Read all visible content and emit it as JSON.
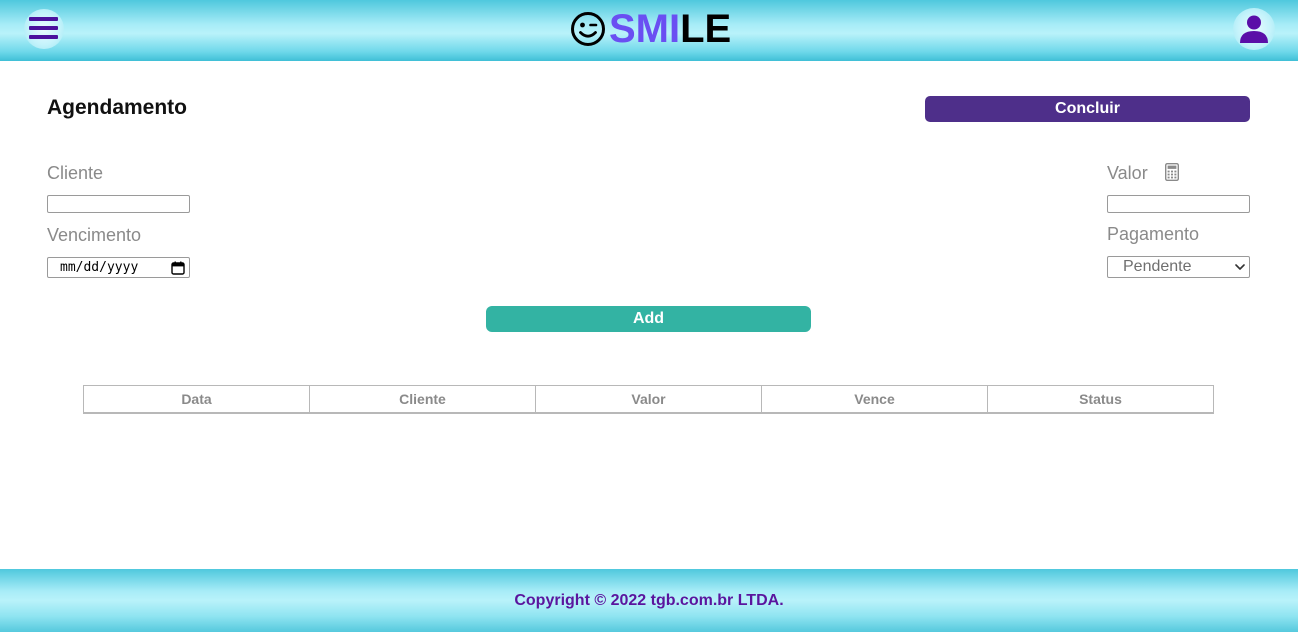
{
  "header": {
    "logo_part1": "SMI",
    "logo_part2": "LE",
    "logo_icon": "winking-smiley-icon",
    "menu_icon": "hamburger-icon",
    "user_icon": "user-icon"
  },
  "main": {
    "title": "Agendamento",
    "concluir_label": "Concluir",
    "add_label": "Add",
    "fields": {
      "cliente_label": "Cliente",
      "cliente_value": "",
      "vencimento_label": "Vencimento",
      "vencimento_placeholder": "mm/dd/yyyy",
      "valor_label": "Valor",
      "valor_value": "",
      "valor_icon": "calculator-icon",
      "pagamento_label": "Pagamento",
      "pagamento_selected": "Pendente"
    },
    "table": {
      "columns": [
        "Data",
        "Cliente",
        "Valor",
        "Vence",
        "Status"
      ],
      "rows": []
    }
  },
  "footer": {
    "copyright": "Copyright © 2022 tgb.com.br LTDA."
  },
  "colors": {
    "brand_purple": "#4e2f8a",
    "logo_purple": "#6a4ff2",
    "add_teal": "#33b3a3",
    "header_cyan": "#a7ecf7",
    "footer_text": "#5a159e"
  }
}
